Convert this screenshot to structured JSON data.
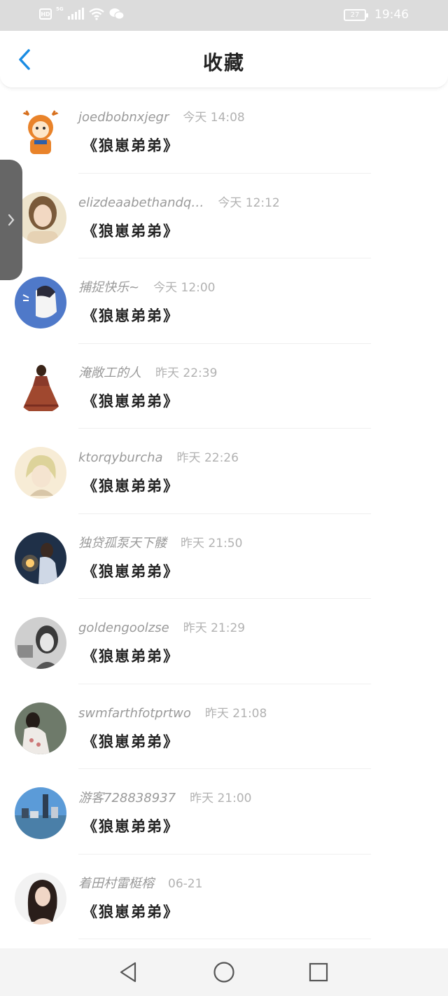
{
  "status_bar": {
    "hd": "HD",
    "network": "5G",
    "battery": "27",
    "time": "19:46",
    "icons": [
      "hd-icon",
      "signal-icon",
      "wifi-icon",
      "wechat-icon",
      "battery-icon"
    ]
  },
  "header": {
    "title": "收藏",
    "back_icon": "chevron-left-icon",
    "accent": "#1a8ce3"
  },
  "items": [
    {
      "username": "joedbobnxjegr",
      "time": "今天 14:08",
      "title": "《狼崽弟弟》"
    },
    {
      "username": "elizdeaabethandq…",
      "time": "今天 12:12",
      "title": "《狼崽弟弟》"
    },
    {
      "username": "捕捉快乐~",
      "time": "今天 12:00",
      "title": "《狼崽弟弟》"
    },
    {
      "username": "淹敞工的人",
      "time": "昨天 22:39",
      "title": "《狼崽弟弟》"
    },
    {
      "username": "ktorqyburcha",
      "time": "昨天 22:26",
      "title": "《狼崽弟弟》"
    },
    {
      "username": "独贷孤泵天下髅",
      "time": "昨天 21:50",
      "title": "《狼崽弟弟》"
    },
    {
      "username": "goldengoolzse",
      "time": "昨天 21:29",
      "title": "《狼崽弟弟》"
    },
    {
      "username": "swmfarthfotprtwo",
      "time": "昨天 21:08",
      "title": "《狼崽弟弟》"
    },
    {
      "username": "游客728838937",
      "time": "昨天 21:00",
      "title": "《狼崽弟弟》"
    },
    {
      "username": "着田村雷梃榕",
      "time": "06-21",
      "title": "《狼崽弟弟》"
    }
  ],
  "side_tab": {
    "icon": "chevron-right-icon"
  },
  "nav_bar": {
    "icons": [
      "back-triangle-icon",
      "home-circle-icon",
      "recents-square-icon"
    ]
  }
}
